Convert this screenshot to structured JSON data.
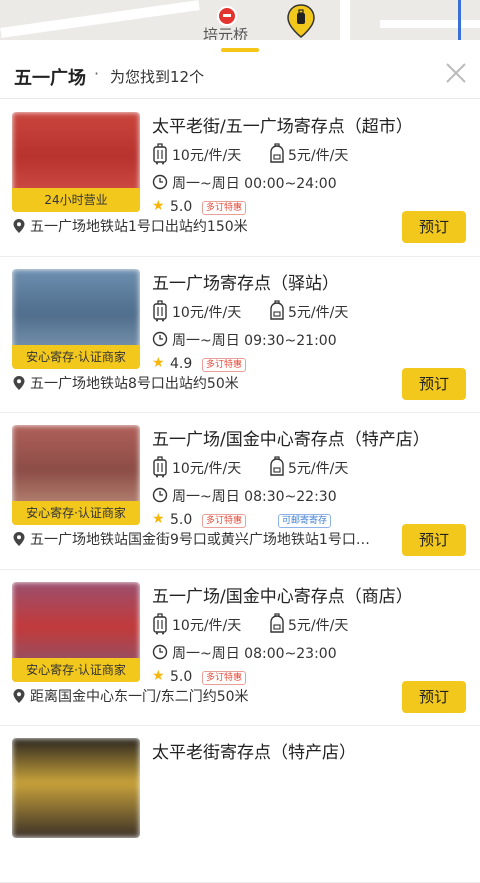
{
  "map": {
    "metro_station_label": "培元桥"
  },
  "header": {
    "title": "五一广场",
    "separator": "·",
    "result_text": "为您找到12个"
  },
  "colors": {
    "accent": "#f3c81c",
    "tag_red": "#e74c3c",
    "tag_blue": "#3b7bd1",
    "star": "#f5b50a"
  },
  "stores": [
    {
      "name": "太平老街/五一广场寄存点（超市）",
      "badge": "24小时营业",
      "luggage_price": "10元/件/天",
      "bag_price": "5元/件/天",
      "hours": "周一~周日 00:00~24:00",
      "rating": "5.0",
      "tags": [
        "多订特惠"
      ],
      "address": "五一广场地铁站1号口出站约150米",
      "book_label": "预订",
      "thumb_colors": [
        "#c9463d",
        "#b8322e",
        "#d85a50"
      ]
    },
    {
      "name": "五一广场寄存点（驿站）",
      "badge": "安心寄存·认证商家",
      "luggage_price": "10元/件/天",
      "bag_price": "5元/件/天",
      "hours": "周一~周日 09:30~21:00",
      "rating": "4.9",
      "tags": [
        "多订特惠"
      ],
      "address": "五一广场地铁站8号口出站约50米",
      "book_label": "预订",
      "thumb_colors": [
        "#6e8fb0",
        "#4f6d8c",
        "#8ba5bf"
      ]
    },
    {
      "name": "五一广场/国金中心寄存点（特产店）",
      "badge": "安心寄存·认证商家",
      "luggage_price": "10元/件/天",
      "bag_price": "5元/件/天",
      "hours": "周一~周日 08:30~22:30",
      "rating": "5.0",
      "tags": [
        "多订特惠",
        "可邮寄寄存"
      ],
      "address": "五一广场地铁站国金街9号口或黄兴广场地铁站1号口…",
      "book_label": "预订",
      "thumb_colors": [
        "#b0605a",
        "#8c4c46",
        "#c9a08a"
      ]
    },
    {
      "name": "五一广场/国金中心寄存点（商店）",
      "badge": "安心寄存·认证商家",
      "luggage_price": "10元/件/天",
      "bag_price": "5元/件/天",
      "hours": "周一~周日 08:00~23:00",
      "rating": "5.0",
      "tags": [
        "多订特惠"
      ],
      "address": "距离国金中心东一门/东二门约50米",
      "book_label": "预订",
      "thumb_colors": [
        "#9a4f6e",
        "#c23a3a",
        "#7c5a7a"
      ]
    },
    {
      "name": "太平老街寄存点（特产店）",
      "badge": "",
      "luggage_price": "",
      "bag_price": "",
      "hours": "",
      "rating": "",
      "tags": [],
      "address": "",
      "book_label": "",
      "thumb_colors": [
        "#2a2620",
        "#c8a23a",
        "#3a3028"
      ]
    }
  ]
}
